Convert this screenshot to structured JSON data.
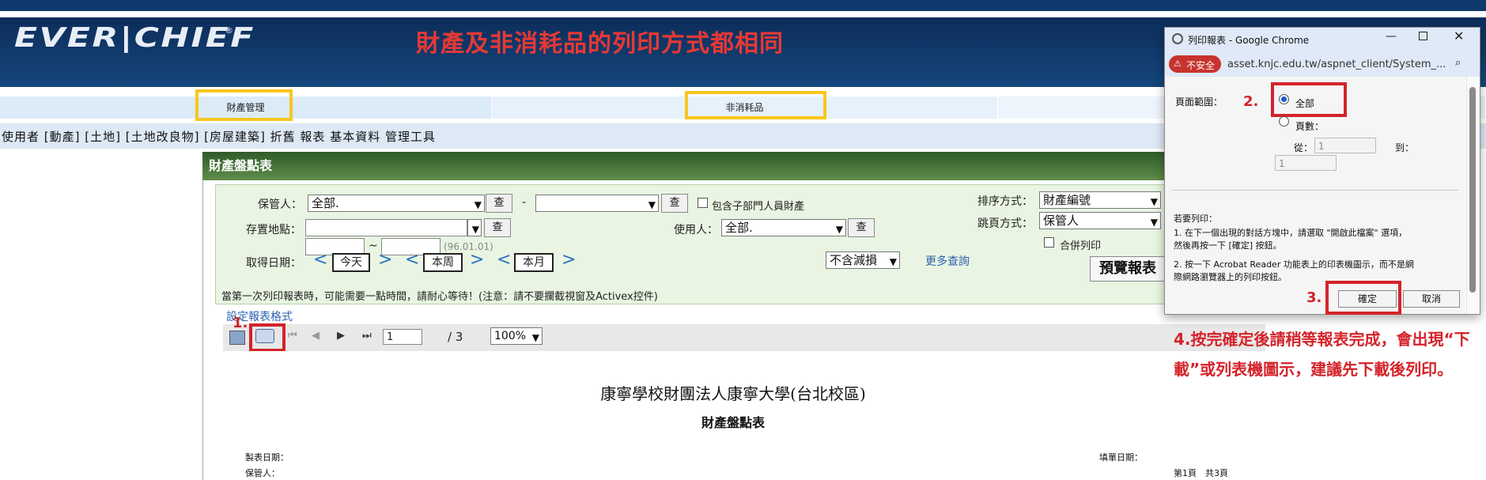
{
  "header": {
    "logo": "EVER|CHIEF",
    "logo_reg": "®",
    "headline": "財產及非消耗品的列印方式都相同"
  },
  "tabs": [
    {
      "label": "財產管理"
    },
    {
      "label": "非消耗品"
    }
  ],
  "menu": {
    "text": "使用者 [動產] [土地] [土地改良物] [房屋建築] 折舊 報表 基本資料 管理工具"
  },
  "panel": {
    "title": "財產盤點表"
  },
  "form": {
    "keeper_label": "保管人：",
    "keeper_value": "全部.",
    "query_label": "查",
    "dash": "-",
    "include_sub_label": "包含子部門人員財產",
    "location_label": "存置地點：",
    "user_label": "使用人：",
    "user_value": "全部.",
    "date_label": "取得日期：",
    "tilde": "~",
    "date_hint": "(96.01.01)",
    "today": "今天",
    "this_week": "本周",
    "this_month": "本月",
    "nav_prev": "<",
    "nav_next": ">",
    "exclude_value": "不含減損",
    "more_query": "更多查詢",
    "sort_label": "排序方式：",
    "sort_value": "財產編號",
    "page_jump_label": "跳頁方式：",
    "page_jump_value": "保管人",
    "merge_print_label": "合併列印",
    "preview_button": "預覽報表",
    "notice": "當第一次列印報表時，可能需要一點時間，請耐心等待！(注意：請不要攔截視窗及Activex控件)",
    "report_format_link": "設定報表格式"
  },
  "toolbar": {
    "page_value": "1",
    "page_total": "/ 3",
    "zoom_value": "100%"
  },
  "report": {
    "title": "康寧學校財團法人康寧大學(台北校區)",
    "subtitle": "財產盤點表",
    "made_date_label": "製表日期：",
    "keeper_label": "保管人：",
    "fill_date_label": "填單日期：",
    "page_info": "第1頁　共3頁"
  },
  "dialog": {
    "title": "列印報表 - Google Chrome",
    "insecure_label": "不安全",
    "url": "asset.knjc.edu.tw/aspnet_client/System_...",
    "range_label": "頁面範圍：",
    "all_label": "全部",
    "pages_label": "頁數：",
    "from_label": "從：",
    "from_value": "1",
    "to_label": "到：",
    "to_value": "1",
    "help_title": "若要列印：",
    "help_1a": "1. 在下一個出現的對話方塊中，請選取 \"開啟此檔案\" 選項，",
    "help_1b": "然後再按一下 [確定] 按鈕。",
    "help_2a": "2. 按一下 Acrobat Reader 功能表上的印表機圖示，而不是網",
    "help_2b": "際網路瀏覽器上的列印按鈕。",
    "ok_label": "確定",
    "cancel_label": "取消"
  },
  "annotations": {
    "step1": "1.",
    "step2": "2.",
    "step3": "3.",
    "note": "4.按完確定後請稍等報表完成，會出現“下載”或列表機圖示，建議先下載後列印。"
  },
  "colors": {
    "header_bg": "#15467d",
    "highlight_yellow": "#f7c61f",
    "highlight_red": "#d4232a",
    "panel_green": "#2f5c2a"
  }
}
